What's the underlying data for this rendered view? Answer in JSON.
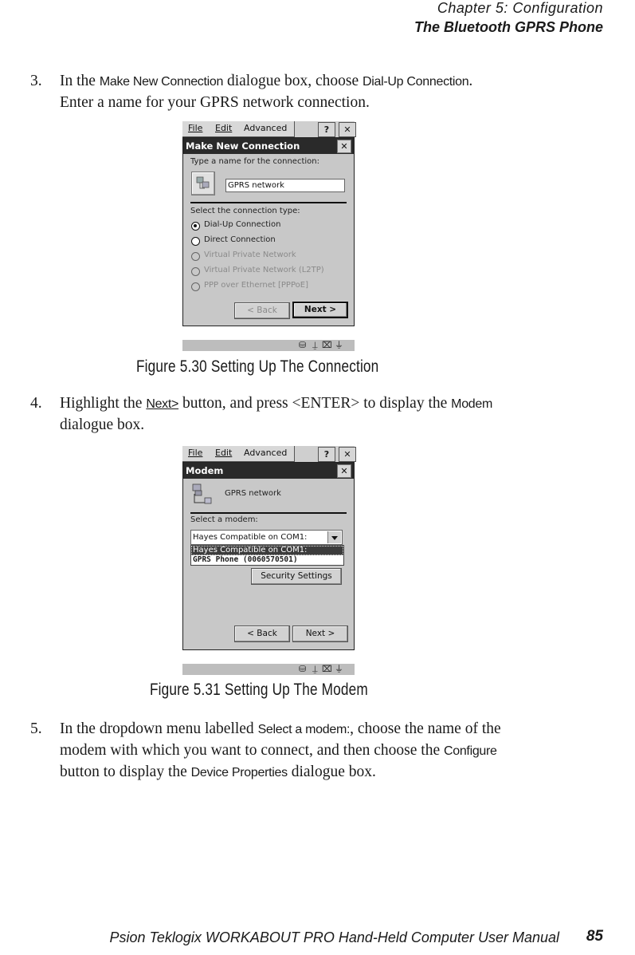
{
  "header": {
    "chapter": "Chapter  5:  Configuration",
    "section": "The Bluetooth GPRS Phone"
  },
  "step3": {
    "number": "3.",
    "t1": "In the ",
    "k1": "Make New Connection",
    "t2": " dialogue box, choose ",
    "k2": "Dial-Up Connection",
    "t3": ".",
    "line2": "Enter a name for your GPRS network connection."
  },
  "fig1": {
    "menubar": {
      "file": "File",
      "edit": "Edit",
      "advanced": "Advanced",
      "help": "?",
      "close": "✕"
    },
    "dialog": {
      "title": "Make New Connection",
      "close": "✕",
      "name_label": "Type a name for the connection:",
      "name_value": "GPRS network",
      "type_label": "Select the connection type:",
      "options": [
        {
          "label": "Dial-Up Connection",
          "selected": true,
          "enabled": true
        },
        {
          "label": "Direct Connection",
          "selected": false,
          "enabled": true
        },
        {
          "label": "Virtual Private Network",
          "selected": false,
          "enabled": false
        },
        {
          "label": "Virtual Private Network (L2TP)",
          "selected": false,
          "enabled": false
        },
        {
          "label": "PPP over Ethernet [PPPoE]",
          "selected": false,
          "enabled": false
        }
      ],
      "back": "< Back",
      "next": "Next >"
    },
    "caption": "Figure  5.30  Setting  Up  The  Connection"
  },
  "step4": {
    "number": "4.",
    "t1": "Highlight the ",
    "k1": "Next>",
    "t2": " button, and press <ENTER> to display the ",
    "k2": "Modem",
    "line2": "dialogue box."
  },
  "fig2": {
    "menubar": {
      "file": "File",
      "edit": "Edit",
      "advanced": "Advanced",
      "help": "?",
      "close": "✕"
    },
    "dialog": {
      "title": "Modem",
      "close": "✕",
      "connection_name": "GPRS network",
      "modem_label": "Select a modem:",
      "modem_value": "Hayes Compatible on COM1:",
      "modem_options": [
        "Hayes Compatible on COM1:",
        "GPRS Phone (0060570501)"
      ],
      "security": "Security Settings",
      "back": "< Back",
      "next": "Next >"
    },
    "caption": "Figure  5.31  Setting  Up  The  Modem"
  },
  "step5": {
    "number": "5.",
    "t1": "In the dropdown menu labelled ",
    "k1": "Select a modem:",
    "t2": ", choose the name of the",
    "line2a": "modem with which you want to connect, and then choose the ",
    "k2": "Configure",
    "line3a": "button to display the ",
    "k3": "Device Properties",
    "line3b": " dialogue box."
  },
  "footer": {
    "manual": "Psion Teklogix WORKABOUT PRO Hand-Held Computer User Manual",
    "page": "85"
  },
  "taskbar_icons": [
    "network-icon",
    "antenna-icon",
    "signal-off-icon",
    "power-plug-icon"
  ]
}
